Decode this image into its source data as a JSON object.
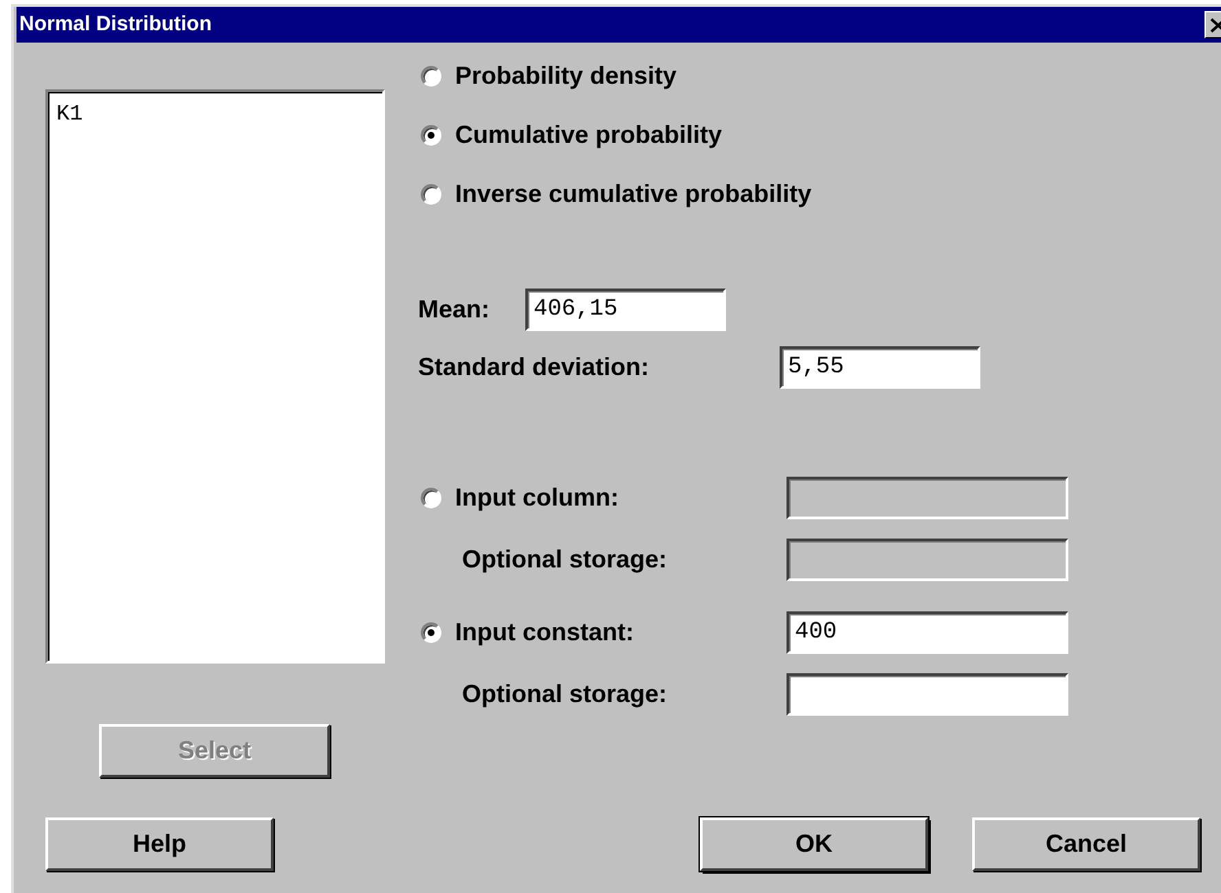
{
  "window": {
    "title": "Normal Distribution"
  },
  "variables": [
    {
      "name": "K1"
    }
  ],
  "select_button": {
    "label": "Select",
    "disabled": true
  },
  "modes": [
    {
      "label": "Probability density",
      "selected": false
    },
    {
      "label": "Cumulative probability",
      "selected": true
    },
    {
      "label": "Inverse cumulative probability",
      "selected": false
    }
  ],
  "mean": {
    "label": "Mean:",
    "value": "406,15"
  },
  "standard_deviation": {
    "label": "Standard deviation:",
    "value": "5,55"
  },
  "inputs": [
    {
      "label": "Input column:",
      "selected": false,
      "disabled": true,
      "storage_label": "Optional storage:"
    },
    {
      "label": "Input constant:",
      "selected": true,
      "disabled": false,
      "value": "400",
      "storage_label": "Optional storage:"
    }
  ],
  "buttons": [
    {
      "label": "Help",
      "default": false
    },
    {
      "label": "OK",
      "default": true
    },
    {
      "label": "Cancel",
      "default": false
    }
  ]
}
